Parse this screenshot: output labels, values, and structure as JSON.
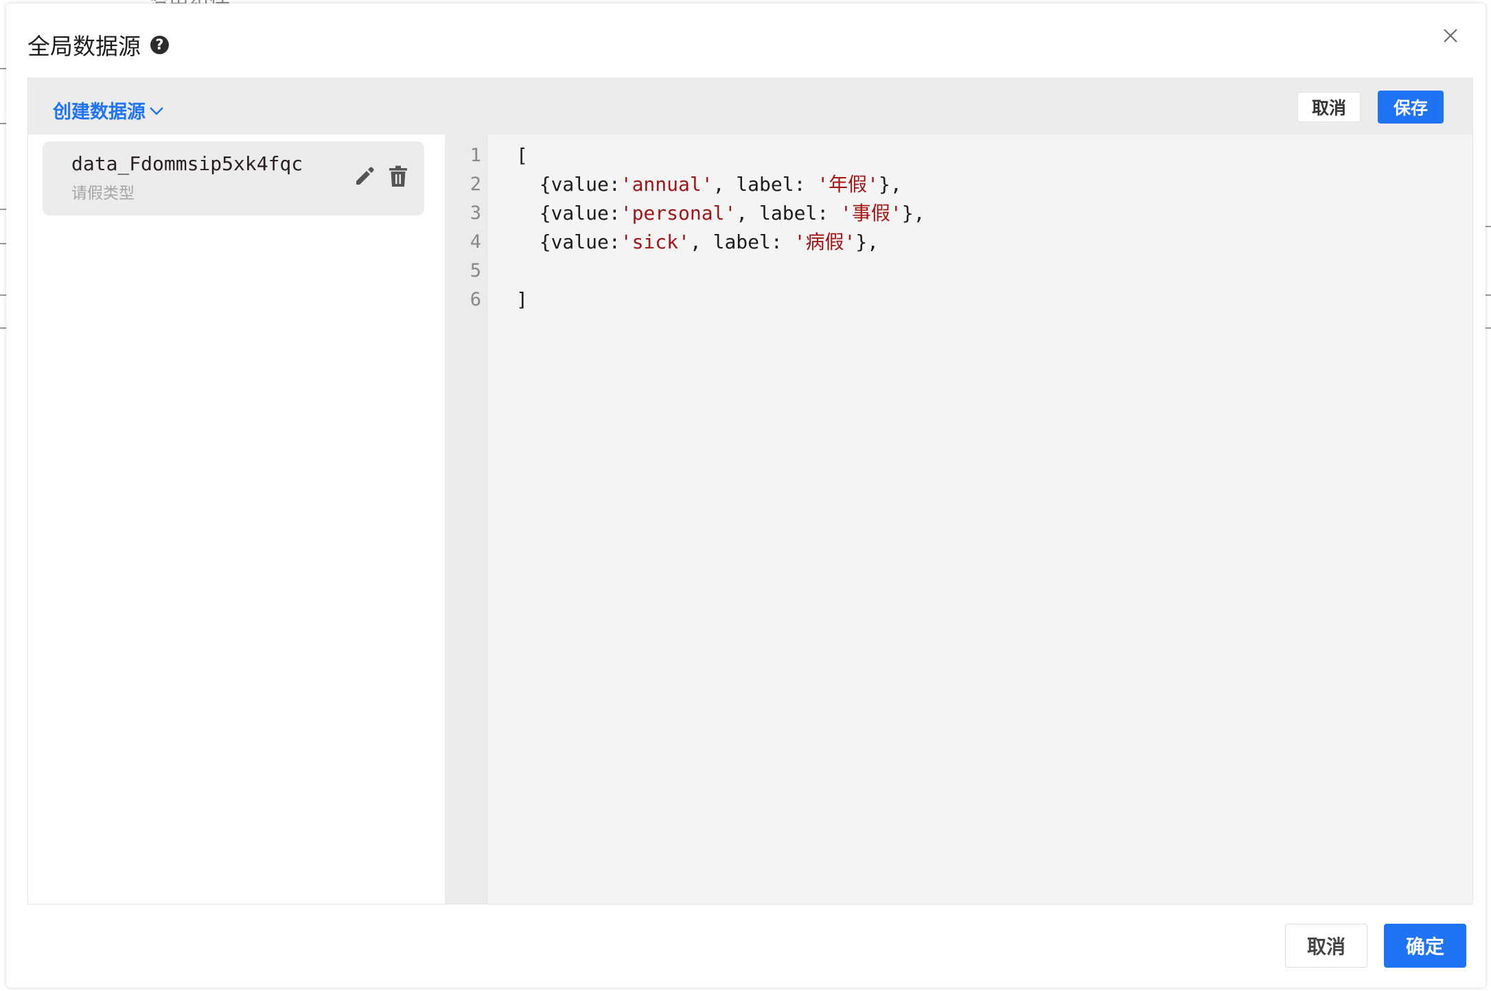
{
  "background": {
    "partial_text": "沿用组件"
  },
  "dialog": {
    "title": "全局数据源",
    "help_glyph": "?",
    "icons": {
      "help": "question-circle-icon",
      "close": "close-icon"
    }
  },
  "toolbar": {
    "create_label": "创建数据源",
    "cancel_label": "取消",
    "save_label": "保存"
  },
  "data_sources": [
    {
      "name": "data_Fdommsip5xk4fqc",
      "description": "请假类型"
    }
  ],
  "editor": {
    "lines": [
      {
        "num": "1",
        "parts": [
          [
            "t",
            "["
          ]
        ]
      },
      {
        "num": "2",
        "parts": [
          [
            "t",
            "  {value:"
          ],
          [
            "s",
            "'annual'"
          ],
          [
            "t",
            ", label: "
          ],
          [
            "s",
            "'年假'"
          ],
          [
            "t",
            "},"
          ]
        ]
      },
      {
        "num": "3",
        "parts": [
          [
            "t",
            "  {value:"
          ],
          [
            "s",
            "'personal'"
          ],
          [
            "t",
            ", label: "
          ],
          [
            "s",
            "'事假'"
          ],
          [
            "t",
            "},"
          ]
        ]
      },
      {
        "num": "4",
        "parts": [
          [
            "t",
            "  {value:"
          ],
          [
            "s",
            "'sick'"
          ],
          [
            "t",
            ", label: "
          ],
          [
            "s",
            "'病假'"
          ],
          [
            "t",
            "},"
          ]
        ]
      },
      {
        "num": "5",
        "parts": [
          [
            "t",
            ""
          ]
        ]
      },
      {
        "num": "6",
        "parts": [
          [
            "t",
            "]"
          ]
        ]
      }
    ]
  },
  "footer": {
    "cancel_label": "取消",
    "confirm_label": "确定"
  },
  "colors": {
    "accent": "#1f74f5",
    "string": "#a31515"
  }
}
